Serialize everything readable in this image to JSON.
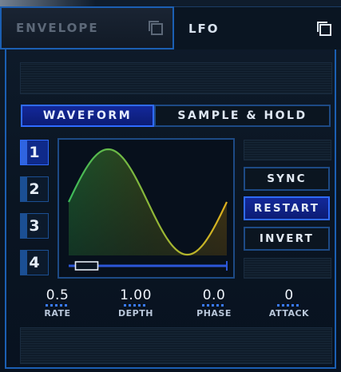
{
  "tabs": [
    {
      "label": "ENVELOPE"
    },
    {
      "label": "LFO"
    }
  ],
  "mode": {
    "waveform_label": "WAVEFORM",
    "sample_hold_label": "SAMPLE & HOLD",
    "selected": "WAVEFORM"
  },
  "lfo_slots": [
    {
      "label": "1"
    },
    {
      "label": "2"
    },
    {
      "label": "3"
    },
    {
      "label": "4"
    }
  ],
  "selected_slot": 1,
  "buttons": {
    "sync_label": "SYNC",
    "restart_label": "RESTART",
    "invert_label": "INVERT"
  },
  "active_button": "RESTART",
  "params": [
    {
      "value": "0.5",
      "label": "RATE"
    },
    {
      "value": "1.00",
      "label": "DEPTH"
    },
    {
      "value": "0.0",
      "label": "PHASE"
    },
    {
      "value": "0",
      "label": "ATTACK"
    }
  ],
  "waveform_shape_position": 0.05,
  "colors": {
    "accent": "#2f6bff",
    "border": "#1d4a85",
    "wave_start": "#3dbb5a",
    "wave_end": "#e0b21e"
  },
  "icons": [
    "popout-icon"
  ]
}
